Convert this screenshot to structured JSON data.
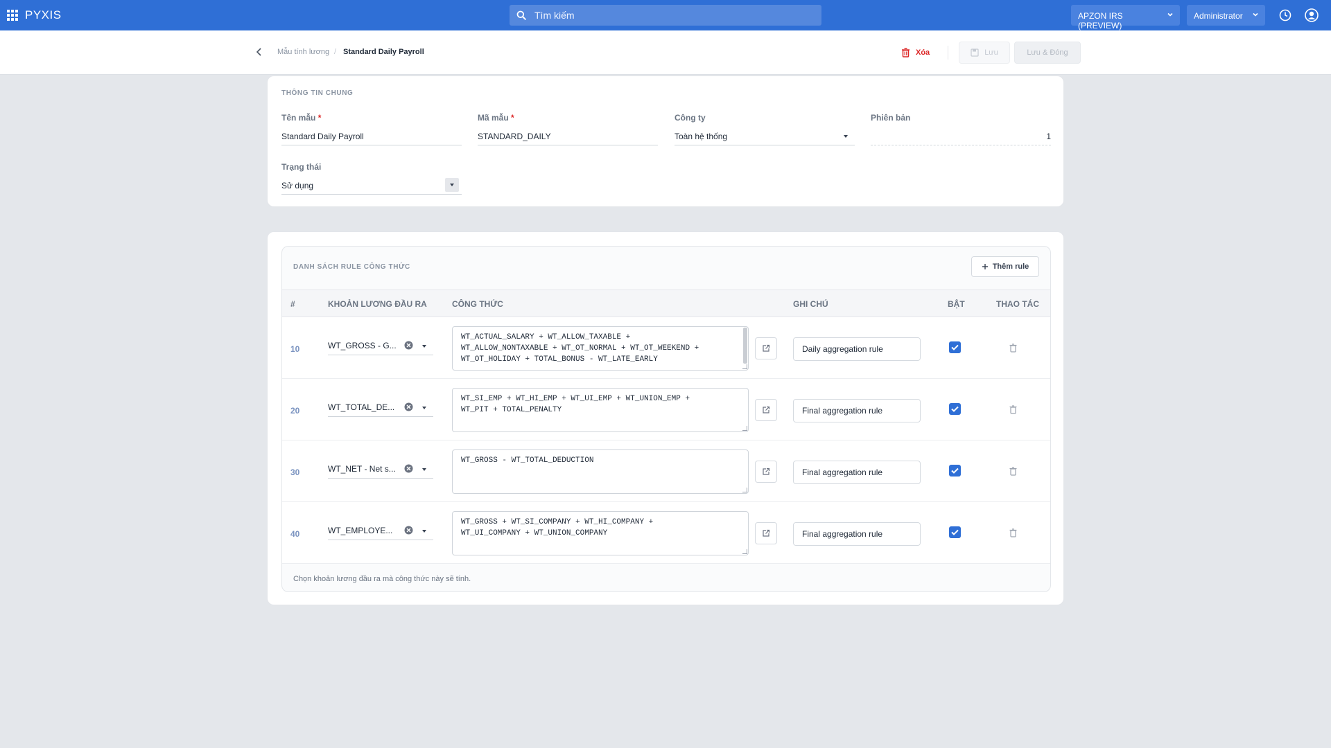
{
  "app": {
    "name": "PYXIS"
  },
  "search": {
    "placeholder": "Tìm kiếm"
  },
  "topbar": {
    "company": "APZON IRS (PREVIEW)",
    "user": "Administrator"
  },
  "breadcrumb": {
    "parent": "Mẫu tính lương",
    "current": "Standard Daily Payroll"
  },
  "actions": {
    "delete": "Xóa",
    "save": "Lưu",
    "save_close": "Lưu & Đóng"
  },
  "general": {
    "section_title": "THÔNG TIN CHUNG",
    "name_label": "Tên mẫu",
    "name_value": "Standard Daily Payroll",
    "code_label": "Mã mẫu",
    "code_value": "STANDARD_DAILY",
    "company_label": "Công ty",
    "company_value": "Toàn hệ thống",
    "version_label": "Phiên bản",
    "version_value": "1",
    "status_label": "Trạng thái",
    "status_value": "Sử dụng",
    "required_mark": "*"
  },
  "rules": {
    "section_title": "DANH SÁCH RULE CÔNG THỨC",
    "add_label": "Thêm rule",
    "columns": [
      "#",
      "KHOẢN LƯƠNG ĐẦU RA",
      "CÔNG THỨC",
      "GHI CHÚ",
      "BẬT",
      "THAO TÁC"
    ],
    "rows": [
      {
        "seq": "10",
        "output": "WT_GROSS - G...",
        "formula": "WT_ACTUAL_SALARY + WT_ALLOW_TAXABLE +\nWT_ALLOW_NONTAXABLE + WT_OT_NORMAL + WT_OT_WEEKEND +\nWT_OT_HOLIDAY + TOTAL_BONUS - WT_LATE_EARLY",
        "note": "Daily aggregation rule",
        "enabled": true
      },
      {
        "seq": "20",
        "output": "WT_TOTAL_DE...",
        "formula": "WT_SI_EMP + WT_HI_EMP + WT_UI_EMP + WT_UNION_EMP +\nWT_PIT + TOTAL_PENALTY",
        "note": "Final aggregation rule",
        "enabled": true
      },
      {
        "seq": "30",
        "output": "WT_NET - Net s...",
        "formula": "WT_GROSS - WT_TOTAL_DEDUCTION",
        "note": "Final aggregation rule",
        "enabled": true
      },
      {
        "seq": "40",
        "output": "WT_EMPLOYE...",
        "formula": "WT_GROSS + WT_SI_COMPANY + WT_HI_COMPANY +\nWT_UI_COMPANY + WT_UNION_COMPANY",
        "note": "Final aggregation rule",
        "enabled": true
      }
    ],
    "hint": "Chọn khoản lương đầu ra mà công thức này sẽ tính."
  },
  "colors": {
    "primary": "#2f6fd6",
    "danger": "#dc2626",
    "background": "#e4e7eb"
  },
  "icons": [
    "apps-grid-icon",
    "search-icon",
    "chevron-down-icon",
    "clock-icon",
    "user-circle-icon",
    "back-arrow-icon",
    "trash-icon",
    "save-icon",
    "plus-icon",
    "clear-icon",
    "external-link-icon",
    "checkbox-checked-icon"
  ]
}
